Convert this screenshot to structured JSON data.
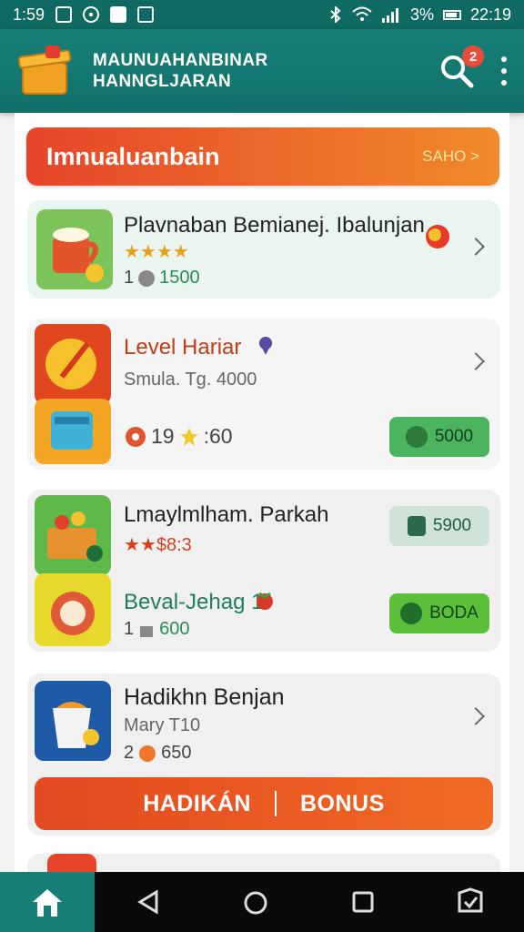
{
  "status_bar": {
    "time": "1:59",
    "battery": "3%",
    "extra": "22:19"
  },
  "header": {
    "title_line1": "MAUNUAHANBINAR",
    "title_line2": "HANNGLJARAN",
    "notification_count": "2",
    "icons": [
      "gift-box-logo",
      "search-icon",
      "more-vert-icon"
    ]
  },
  "promo": {
    "title": "Imnualuanbain",
    "action": "SAHO >"
  },
  "cards": [
    {
      "title": "Plavnaban Bemianej. Ibalunjan",
      "rating_text": "★★★★",
      "meta_left": "1",
      "meta_value": "1500"
    },
    {
      "title": "Level Hariar",
      "subtitle": "Smula. Tg. 4000",
      "meta_left": "19",
      "meta_value": ":60",
      "button": "5000"
    },
    {
      "title": "Lmaylmlham. Parkah",
      "rating_text": "★★$8:3",
      "button": "5900",
      "title2": "Beval-Jehag 1",
      "meta_left": "1",
      "meta_value": "600",
      "button2": "BODA"
    },
    {
      "title": "Hadikhn Benjan",
      "subtitle": "Mary T10",
      "meta_left": "2",
      "meta_value": "650",
      "bonus_left": "HADIKÁN",
      "bonus_right": "BONUS"
    }
  ],
  "colors": {
    "teal": "#178076",
    "orange": "#e8502a",
    "green": "#4cb35f"
  }
}
